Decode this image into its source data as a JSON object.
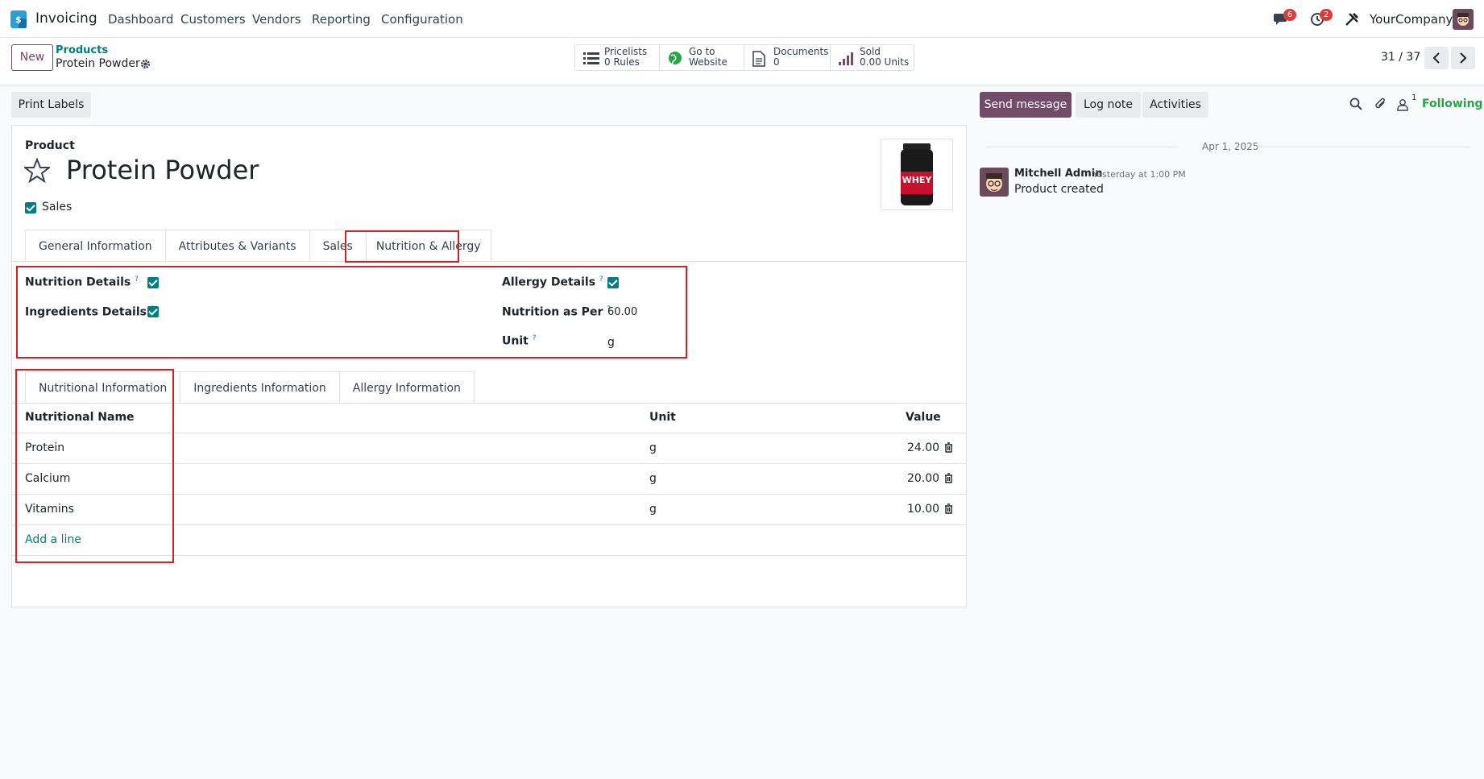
{
  "navbar": {
    "app_name": "Invoicing",
    "menu": [
      "Dashboard",
      "Customers",
      "Vendors",
      "Reporting",
      "Configuration"
    ],
    "messages_count": "6",
    "activities_count": "2",
    "company": "YourCompany"
  },
  "control_panel": {
    "new_label": "New",
    "breadcrumb_parent": "Products",
    "breadcrumb_current": "Protein Powder",
    "smart_buttons": [
      {
        "icon": "list-icon",
        "line1": "Pricelists",
        "line2": "0 Rules"
      },
      {
        "icon": "globe-icon",
        "line1": "Go to",
        "line2": "Website"
      },
      {
        "icon": "document-icon",
        "line1": "Documents",
        "line2": "0"
      },
      {
        "icon": "bar-chart-icon",
        "line1": "Sold",
        "line2": "0.00 Units"
      }
    ],
    "pager": "31 / 37"
  },
  "form": {
    "print_labels": "Print Labels",
    "product_label": "Product",
    "product_name": "Protein Powder",
    "sales_checkbox_label": "Sales",
    "tabs": [
      "General Information",
      "Attributes & Variants",
      "Sales",
      "Nutrition & Allergy"
    ],
    "fields": {
      "nutrition_details": "Nutrition Details",
      "ingredients_details": "Ingredients Details",
      "allergy_details": "Allergy Details",
      "nutrition_as_per": "Nutrition as Per",
      "nutrition_as_per_value": "60.00",
      "unit": "Unit",
      "unit_value": "g",
      "help_mark": "?"
    },
    "sub_tabs": [
      "Nutritional Information",
      "Ingredients Information",
      "Allergy Information"
    ],
    "table": {
      "headers": [
        "Nutritional Name",
        "Unit",
        "Value"
      ],
      "rows": [
        {
          "name": "Protein",
          "unit": "g",
          "value": "24.00"
        },
        {
          "name": "Calcium",
          "unit": "g",
          "value": "20.00"
        },
        {
          "name": "Vitamins",
          "unit": "g",
          "value": "10.00"
        }
      ],
      "add_line": "Add a line"
    },
    "image_label": "WHEY"
  },
  "chatter": {
    "send_message": "Send message",
    "log_note": "Log note",
    "activities": "Activities",
    "followers_count": "1",
    "following": "Following",
    "date": "Apr 1, 2025",
    "author": "Mitchell Admin",
    "time": "Yesterday at 1:00 PM",
    "message": "Product created"
  },
  "colors": {
    "brand": "#714b67",
    "teal": "#017e84",
    "highlight": "#d0232b"
  }
}
